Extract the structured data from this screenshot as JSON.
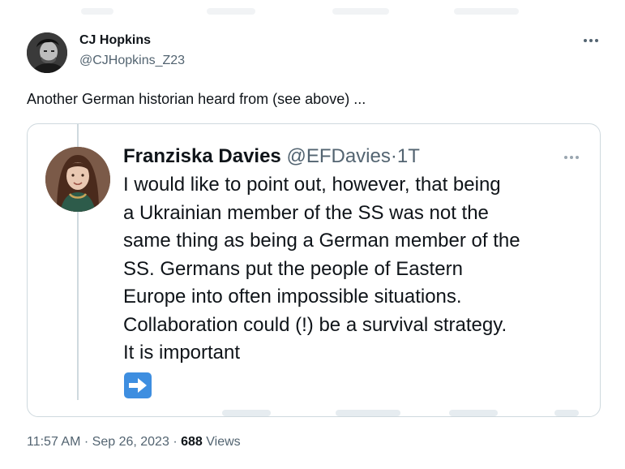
{
  "tweet": {
    "author": {
      "name": "CJ Hopkins",
      "handle": "@CJHopkins_Z23"
    },
    "text": "Another German historian heard from (see above) ...",
    "quoted": {
      "author_name": "Franziska Davies",
      "author_handle": "@EFDavies",
      "separator": "·",
      "time": "1T",
      "lines": [
        "I would like to point out, however, that being",
        "a Ukrainian member of the SS was not the",
        "same thing as being a German member of the",
        "SS. Germans put the people of Eastern",
        "Europe into often impossible situations.",
        "Collaboration could (!) be a survival strategy.",
        "It is important"
      ],
      "trailing_emoji": "right-arrow-emoji"
    },
    "meta": {
      "time": "11:57 AM",
      "dot1": "·",
      "date": "Sep 26, 2023",
      "dot2": "·",
      "views_count": "688",
      "views_label": "Views"
    }
  },
  "icons": {
    "more": "more-horizontal-icon",
    "arrow": "right-arrow-icon"
  },
  "colors": {
    "text_primary": "#0f1419",
    "text_secondary": "#536471",
    "border": "#cfd9de",
    "arrow_emoji_bg": "#3e8ee0"
  }
}
